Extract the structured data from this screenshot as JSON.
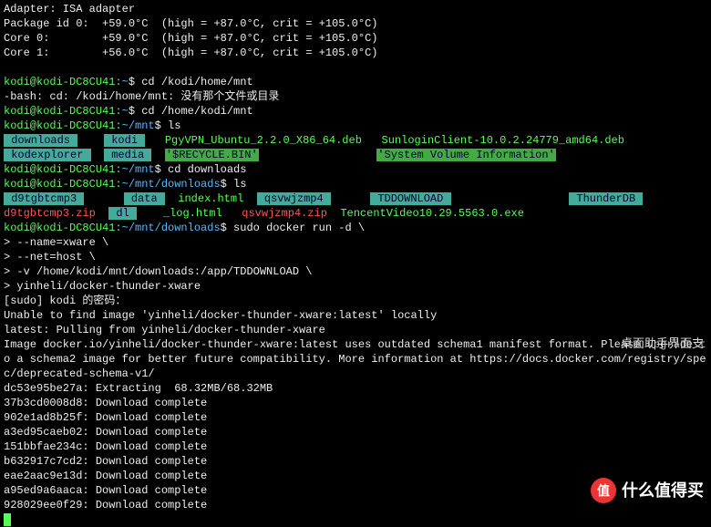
{
  "sensors": {
    "adapter": "Adapter: ISA adapter",
    "pkg": "Package id 0:  +59.0°C  (high = +87.0°C, crit = +105.0°C)",
    "core0": "Core 0:        +59.0°C  (high = +87.0°C, crit = +105.0°C)",
    "core1": "Core 1:        +56.0°C  (high = +87.0°C, crit = +105.0°C)"
  },
  "p1": {
    "user_host": "kodi@kodi-DC8CU41:",
    "path": "~",
    "cmd": " cd /kodi/home/mnt"
  },
  "err1": "-bash: cd: /kodi/home/mnt: 没有那个文件或目录",
  "p2": {
    "user_host": "kodi@kodi-DC8CU41:",
    "path": "~",
    "cmd": " cd /home/kodi/mnt"
  },
  "p3": {
    "user_host": "kodi@kodi-DC8CU41:",
    "path": "~/mnt",
    "cmd": " ls"
  },
  "ls1": {
    "a": " downloads ",
    "b": " kodi ",
    "c": "PgyVPN_Ubuntu_2.2.0_X86_64.deb",
    "d": "SunloginClient-10.0.2.24779_amd64.deb",
    "e": " kodexplorer ",
    "f": " media ",
    "g": "'$RECYCLE.BIN'",
    "h": "'System Volume Information'"
  },
  "p4": {
    "user_host": "kodi@kodi-DC8CU41:",
    "path": "~/mnt",
    "cmd": " cd downloads"
  },
  "p5": {
    "user_host": "kodi@kodi-DC8CU41:",
    "path": "~/mnt/downloads",
    "cmd": " ls"
  },
  "ls2": {
    "a1": " d9tgbtcmp3 ",
    "a2": " data ",
    "a3": "index.html",
    "a4": " qsvwjzmp4 ",
    "a5": " TDDOWNLOAD ",
    "a6": " ThunderDB ",
    "b1": "d9tgbtcmp3.zip",
    "b2": " dl ",
    "b3": "_log.html",
    "b4": "qsvwjzmp4.zip",
    "b5": "TencentVideo10.29.5563.0.exe"
  },
  "p6": {
    "user_host": "kodi@kodi-DC8CU41:",
    "path": "~/mnt/downloads",
    "cmd": " sudo docker run -d \\"
  },
  "cont": {
    "c1": "> --name=xware \\",
    "c2": "> --net=host \\",
    "c3": "> -v /home/kodi/mnt/downloads:/app/TDDOWNLOAD \\",
    "c4": "> yinheli/docker-thunder-xware"
  },
  "sudo": "[sudo] kodi 的密码：",
  "pull": {
    "l1": "Unable to find image 'yinheli/docker-thunder-xware:latest' locally",
    "l2": "latest: Pulling from yinheli/docker-thunder-xware",
    "l3": "Image docker.io/yinheli/docker-thunder-xware:latest uses outdated schema1 manifest format. Please upgrade t",
    "l4": "o a schema2 image for better future compatibility. More information at https://docs.docker.com/registry/spe",
    "l5": "c/deprecated-schema-v1/",
    "l6": "dc53e95be27a: Extracting  68.32MB/68.32MB",
    "l7": "37b3cd0008d8: Download complete",
    "l8": "902e1ad8b25f: Download complete",
    "l9": "a3ed95caeb02: Download complete",
    "l10": "151bbfae234c: Download complete",
    "l11": "b632917c7cd2: Download complete",
    "l12": "eae2aac9e13d: Download complete",
    "l13": "a95ed9a6aaca: Download complete",
    "l14": "928029ee0f29: Download complete"
  },
  "notification": "桌面助手界面支",
  "watermark": {
    "icon": "值",
    "text": "什么值得买"
  }
}
